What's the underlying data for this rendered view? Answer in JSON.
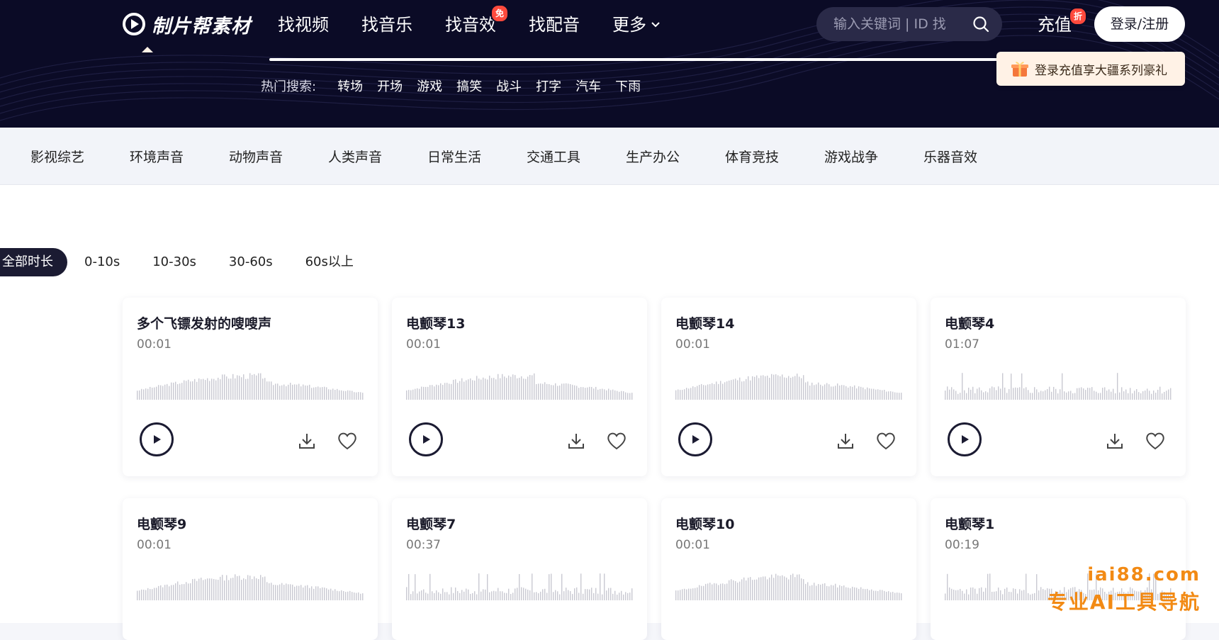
{
  "header": {
    "logo_text": "制片帮素材",
    "nav": [
      {
        "label": "找视频",
        "badge": ""
      },
      {
        "label": "找音乐",
        "badge": ""
      },
      {
        "label": "找音效",
        "badge": "免"
      },
      {
        "label": "找配音",
        "badge": ""
      },
      {
        "label": "更多",
        "badge": ""
      }
    ],
    "search_placeholder": "输入关键词 | ID 找",
    "recharge_label": "充值",
    "recharge_badge": "折",
    "login_label": "登录/注册",
    "promo_text": "登录充值享大疆系列豪礼",
    "hot_label": "热门搜索:",
    "hot_tags": [
      "转场",
      "开场",
      "游戏",
      "搞笑",
      "战斗",
      "打字",
      "汽车",
      "下雨"
    ]
  },
  "categories": [
    "影视综艺",
    "环境声音",
    "动物声音",
    "人类声音",
    "日常生活",
    "交通工具",
    "生产办公",
    "体育竞技",
    "游戏战争",
    "乐器音效"
  ],
  "durations": [
    "全部时长",
    "0-10s",
    "10-30s",
    "30-60s",
    "60s以上"
  ],
  "cards": [
    {
      "title": "多个飞镖发射的嗖嗖声",
      "duration": "00:01"
    },
    {
      "title": "电颤琴13",
      "duration": "00:01"
    },
    {
      "title": "电颤琴14",
      "duration": "00:01"
    },
    {
      "title": "电颤琴4",
      "duration": "01:07"
    },
    {
      "title": "电颤琴9",
      "duration": "00:01"
    },
    {
      "title": "电颤琴7",
      "duration": "00:37"
    },
    {
      "title": "电颤琴10",
      "duration": "00:01"
    },
    {
      "title": "电颤琴1",
      "duration": "00:19"
    }
  ],
  "watermark": {
    "line1": "iai88.com",
    "line2": "专业AI工具导航"
  },
  "colors": {
    "header_bg": "#0b0b26",
    "accent_badge": "#ff4a3d",
    "wave": "#c9c9d2",
    "play": "#1b1b32"
  }
}
